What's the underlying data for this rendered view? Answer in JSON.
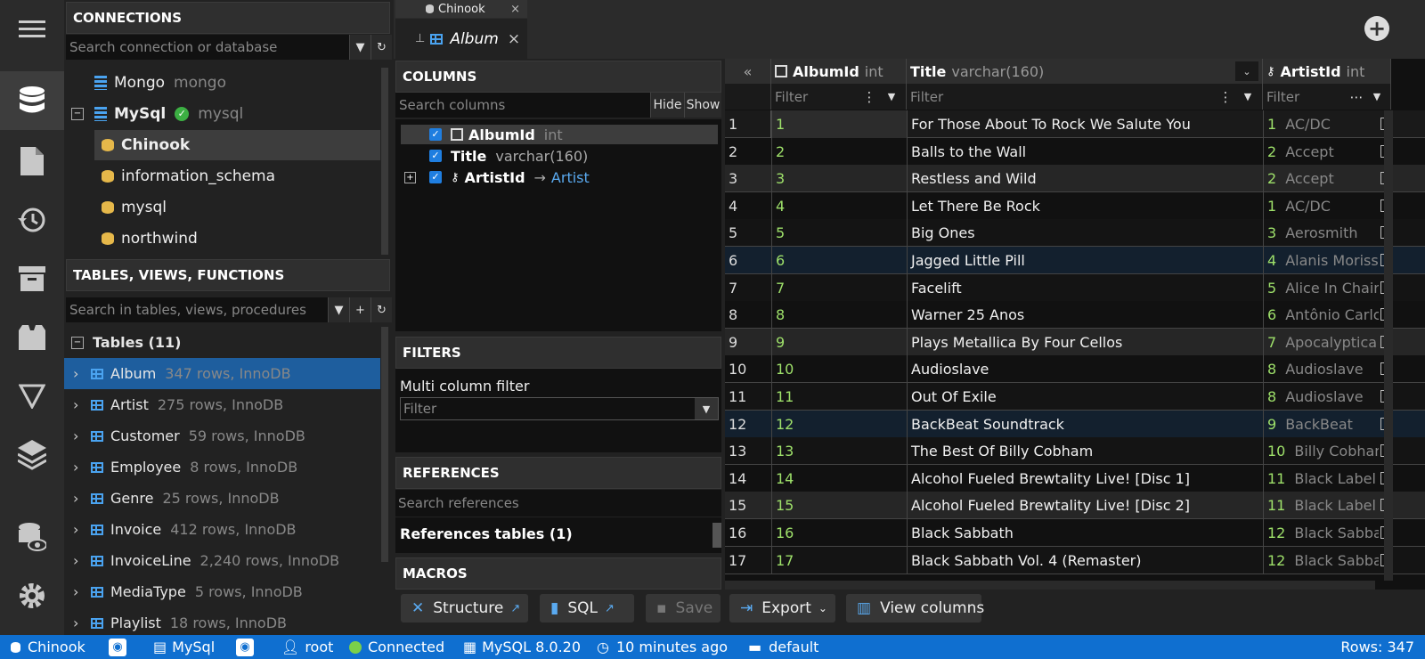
{
  "sidebar_rail": {
    "icons": [
      "menu-icon",
      "database-icon",
      "file-icon",
      "history-icon",
      "archive-icon",
      "box-icon",
      "filter-triangle-icon",
      "layers-icon",
      "database-eye-icon",
      "settings-icon"
    ]
  },
  "connections": {
    "title": "CONNECTIONS",
    "search_placeholder": "Search connection or database",
    "items": [
      {
        "label": "Mongo",
        "sub": "mongo",
        "level": 0
      },
      {
        "label": "MySql",
        "sub": "mysql",
        "level": 0,
        "status": "connected"
      },
      {
        "label": "Chinook",
        "level": 1,
        "selected": true
      },
      {
        "label": "information_schema",
        "level": 1
      },
      {
        "label": "mysql",
        "level": 1
      },
      {
        "label": "northwind",
        "level": 1
      }
    ]
  },
  "tables": {
    "title": "TABLES, VIEWS, FUNCTIONS",
    "search_placeholder": "Search in tables, views, procedures",
    "group_label": "Tables (11)",
    "items": [
      {
        "name": "Album",
        "info": "347 rows, InnoDB",
        "selected": true
      },
      {
        "name": "Artist",
        "info": "275 rows, InnoDB"
      },
      {
        "name": "Customer",
        "info": "59 rows, InnoDB"
      },
      {
        "name": "Employee",
        "info": "8 rows, InnoDB"
      },
      {
        "name": "Genre",
        "info": "25 rows, InnoDB"
      },
      {
        "name": "Invoice",
        "info": "412 rows, InnoDB"
      },
      {
        "name": "InvoiceLine",
        "info": "2,240 rows, InnoDB"
      },
      {
        "name": "MediaType",
        "info": "5 rows, InnoDB"
      },
      {
        "name": "Playlist",
        "info": "18 rows, InnoDB"
      }
    ]
  },
  "tabs": {
    "db_tab": "Chinook",
    "active_tab": "Album"
  },
  "columns_panel": {
    "title": "COLUMNS",
    "search_placeholder": "Search columns",
    "hide_label": "Hide",
    "show_label": "Show",
    "items": [
      {
        "name": "AlbumId",
        "type": "int",
        "checked": true
      },
      {
        "name": "Title",
        "type": "varchar(160)",
        "checked": true
      },
      {
        "name": "ArtistId",
        "type": "",
        "ref": "Artist",
        "checked": true
      }
    ],
    "ref_arrow": "→"
  },
  "filters_panel": {
    "title": "FILTERS",
    "multi_label": "Multi column filter",
    "filter_placeholder": "Filter"
  },
  "references_panel": {
    "title": "REFERENCES",
    "search_placeholder": "Search references",
    "tables_label": "References tables (1)"
  },
  "macros_panel": {
    "title": "MACROS"
  },
  "grid": {
    "collapse_glyph": "«",
    "columns": [
      {
        "name": "AlbumId",
        "type": "int"
      },
      {
        "name": "Title",
        "type": "varchar(160)"
      },
      {
        "name": "ArtistId",
        "type": "int"
      }
    ],
    "filter_placeholder": "Filter",
    "rows": [
      {
        "n": "1",
        "id": "1",
        "title": "For Those About To Rock We Salute You",
        "aid": "1",
        "artist": "AC/DC"
      },
      {
        "n": "2",
        "id": "2",
        "title": "Balls to the Wall",
        "aid": "2",
        "artist": "Accept"
      },
      {
        "n": "3",
        "id": "3",
        "title": "Restless and Wild",
        "aid": "2",
        "artist": "Accept"
      },
      {
        "n": "4",
        "id": "4",
        "title": "Let There Be Rock",
        "aid": "1",
        "artist": "AC/DC"
      },
      {
        "n": "5",
        "id": "5",
        "title": "Big Ones",
        "aid": "3",
        "artist": "Aerosmith"
      },
      {
        "n": "6",
        "id": "6",
        "title": "Jagged Little Pill",
        "aid": "4",
        "artist": "Alanis Morisse"
      },
      {
        "n": "7",
        "id": "7",
        "title": "Facelift",
        "aid": "5",
        "artist": "Alice In Chain"
      },
      {
        "n": "8",
        "id": "8",
        "title": "Warner 25 Anos",
        "aid": "6",
        "artist": "Antônio Carlc"
      },
      {
        "n": "9",
        "id": "9",
        "title": "Plays Metallica By Four Cellos",
        "aid": "7",
        "artist": "Apocalyptica"
      },
      {
        "n": "10",
        "id": "10",
        "title": "Audioslave",
        "aid": "8",
        "artist": "Audioslave"
      },
      {
        "n": "11",
        "id": "11",
        "title": "Out Of Exile",
        "aid": "8",
        "artist": "Audioslave"
      },
      {
        "n": "12",
        "id": "12",
        "title": "BackBeat Soundtrack",
        "aid": "9",
        "artist": "BackBeat"
      },
      {
        "n": "13",
        "id": "13",
        "title": "The Best Of Billy Cobham",
        "aid": "10",
        "artist": "Billy Cobhan"
      },
      {
        "n": "14",
        "id": "14",
        "title": "Alcohol Fueled Brewtality Live! [Disc 1]",
        "aid": "11",
        "artist": "Black Label S"
      },
      {
        "n": "15",
        "id": "15",
        "title": "Alcohol Fueled Brewtality Live! [Disc 2]",
        "aid": "11",
        "artist": "Black Label S"
      },
      {
        "n": "16",
        "id": "16",
        "title": "Black Sabbath",
        "aid": "12",
        "artist": "Black Sabbat"
      },
      {
        "n": "17",
        "id": "17",
        "title": "Black Sabbath Vol. 4 (Remaster)",
        "aid": "12",
        "artist": "Black Sabbat"
      }
    ]
  },
  "toolbar": {
    "structure": "Structure",
    "sql": "SQL",
    "save": "Save",
    "export": "Export",
    "view_columns": "View columns"
  },
  "status": {
    "db": "Chinook",
    "server": "MySql",
    "user": "root",
    "conn": "Connected",
    "version": "MySQL 8.0.20",
    "time": "10 minutes ago",
    "schema": "default",
    "rows": "Rows: 347"
  },
  "colors": {
    "accent": "#0f6fd0",
    "selection": "#1e5e9e",
    "id_green": "#9ee06a"
  }
}
